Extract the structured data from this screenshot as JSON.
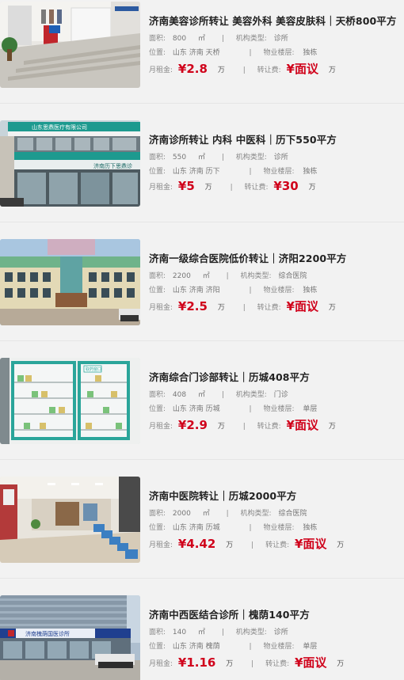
{
  "listings": [
    {
      "title": "济南美容诊所转让 美容外科 美容皮肤科｜天桥800平方",
      "area_label": "面积:",
      "area_value": "800",
      "area_unit": "㎡",
      "type_label": "机构类型:",
      "type_value": "诊所",
      "location_label": "位置:",
      "location_value": "山东 济南 天桥",
      "floor_label": "物业楼层:",
      "floor_value": "独栋",
      "rent_label": "月租金:",
      "rent_value": "¥2.8",
      "rent_unit": "万",
      "fee_label": "转让费:",
      "fee_value": "¥面议",
      "fee_unit": "万",
      "image_icon": "clinic-lobby-photo"
    },
    {
      "title": "济南诊所转让 内科 中医科｜历下550平方",
      "area_label": "面积:",
      "area_value": "550",
      "area_unit": "㎡",
      "type_label": "机构类型:",
      "type_value": "诊所",
      "location_label": "位置:",
      "location_value": "山东 济南 历下",
      "floor_label": "物业楼层:",
      "floor_value": "独栋",
      "rent_label": "月租金:",
      "rent_value": "¥5",
      "rent_unit": "万",
      "fee_label": "转让费:",
      "fee_value": "¥30",
      "fee_unit": "万",
      "image_icon": "storefront-photo",
      "sign_text_top": "山东思鼎医疗有限公司",
      "sign_text_bottom": "济南历下思鼎诊"
    },
    {
      "title": "济南一级综合医院低价转让｜济阳2200平方",
      "area_label": "面积:",
      "area_value": "2200",
      "area_unit": "㎡",
      "type_label": "机构类型:",
      "type_value": "综合医院",
      "location_label": "位置:",
      "location_value": "山东 济南 济阳",
      "floor_label": "物业楼层:",
      "floor_value": "独栋",
      "rent_label": "月租金:",
      "rent_value": "¥2.5",
      "rent_unit": "万",
      "fee_label": "转让费:",
      "fee_value": "¥面议",
      "fee_unit": "万",
      "image_icon": "hospital-building-photo"
    },
    {
      "title": "济南综合门诊部转让｜历城408平方",
      "area_label": "面积:",
      "area_value": "408",
      "area_unit": "㎡",
      "type_label": "机构类型:",
      "type_value": "门诊",
      "location_label": "位置:",
      "location_value": "山东 济南 历城",
      "floor_label": "物业楼层:",
      "floor_value": "单层",
      "rent_label": "月租金:",
      "rent_value": "¥2.9",
      "rent_unit": "万",
      "fee_label": "转让费:",
      "fee_value": "¥面议",
      "fee_unit": "万",
      "image_icon": "pharmacy-shelves-photo",
      "sign_text": "取药窗口"
    },
    {
      "title": "济南中医院转让｜历城2000平方",
      "area_label": "面积:",
      "area_value": "2000",
      "area_unit": "㎡",
      "type_label": "机构类型:",
      "type_value": "综合医院",
      "location_label": "位置:",
      "location_value": "山东 济南 历城",
      "floor_label": "物业楼层:",
      "floor_value": "独栋",
      "rent_label": "月租金:",
      "rent_value": "¥4.42",
      "rent_unit": "万",
      "fee_label": "转让费:",
      "fee_value": "¥面议",
      "fee_unit": "万",
      "image_icon": "waiting-hall-photo"
    },
    {
      "title": "济南中西医结合诊所｜槐荫140平方",
      "area_label": "面积:",
      "area_value": "140",
      "area_unit": "㎡",
      "type_label": "机构类型:",
      "type_value": "诊所",
      "location_label": "位置:",
      "location_value": "山东 济南 槐荫",
      "floor_label": "物业楼层:",
      "floor_value": "单层",
      "rent_label": "月租金:",
      "rent_value": "¥1.16",
      "rent_unit": "万",
      "fee_label": "转让费:",
      "fee_value": "¥面议",
      "fee_unit": "万",
      "image_icon": "clinic-exterior-photo",
      "sign_text": "济南槐荫国医诊所"
    }
  ]
}
